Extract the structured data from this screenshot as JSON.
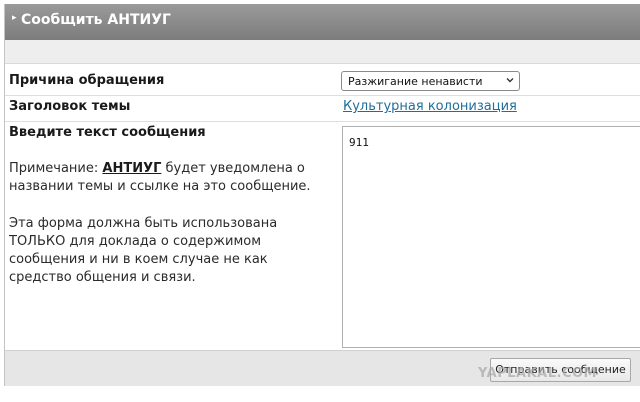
{
  "header": {
    "title": "Сообщить АНТИУГ"
  },
  "form": {
    "reason_label": "Причина обращения",
    "reason_selected": "Разжигание ненависти",
    "topic_label": "Заголовок темы",
    "topic_link": "Культурная колонизация",
    "message_label": "Введите текст сообщения",
    "note_prefix": "Примечание: ",
    "note_brand": "АНТИУГ",
    "note_suffix": " будет уведомлена о названии темы и ссылке на это сообщение.",
    "warning": "Эта форма должна быть использована ТОЛЬКО для доклада о содержимом сообщения и ни в коем случае не как средство общения и связи.",
    "message_value": "911",
    "submit_label": "Отправить сообщение"
  },
  "icons": {
    "header_arrow": "triangle-right-icon",
    "select_chevron": "chevron-down-icon"
  },
  "watermark": "YAPLAKAL.COM"
}
